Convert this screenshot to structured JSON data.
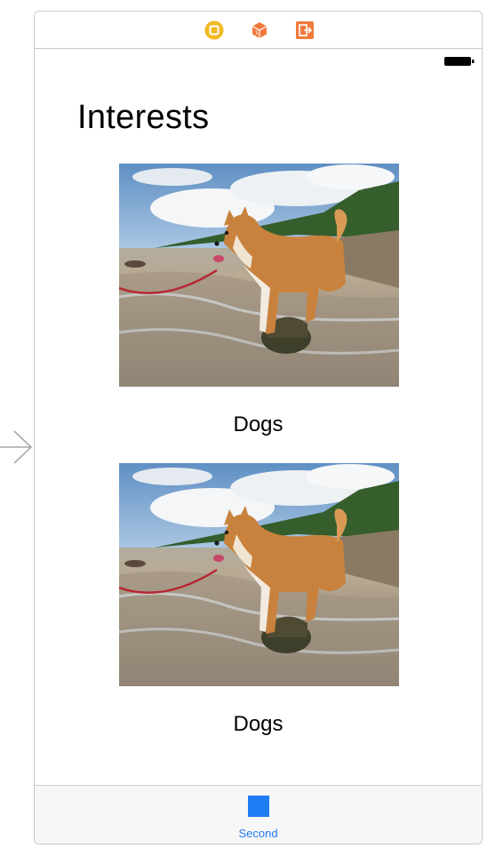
{
  "scene": {
    "dock_icons": [
      "view-controller-icon",
      "first-responder-icon",
      "exit-icon"
    ]
  },
  "status_bar": {
    "battery_icon": "battery-icon"
  },
  "main": {
    "title": "Interests",
    "cards": [
      {
        "image": "shiba-inu-dog-on-beach-photo",
        "caption": "Dogs"
      },
      {
        "image": "shiba-inu-dog-on-beach-photo",
        "caption": "Dogs"
      }
    ]
  },
  "tab_bar": {
    "items": [
      {
        "label": "Second",
        "icon": "square-tab-icon",
        "color": "#1E7CF5"
      }
    ]
  },
  "colors": {
    "accent": "#1E7CF5",
    "view_controller_icon": "#F2B822",
    "object_icons": "#F07A3C"
  }
}
